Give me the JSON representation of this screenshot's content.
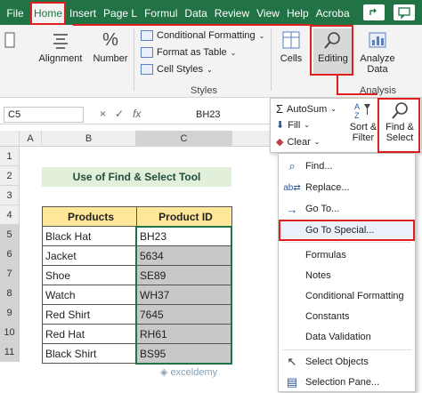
{
  "tabs": [
    "File",
    "Home",
    "Insert",
    "Page L",
    "Formul",
    "Data",
    "Review",
    "View",
    "Help",
    "Acroba"
  ],
  "ribbon": {
    "alignment_label": "Alignment",
    "number_label": "Number",
    "conditional_formatting": "Conditional Formatting",
    "format_as_table": "Format as Table",
    "cell_styles": "Cell Styles",
    "styles_group": "Styles",
    "cells_label": "Cells",
    "editing_label": "Editing",
    "analyze_label_1": "Analyze",
    "analyze_label_2": "Data",
    "analysis_group": "Analysis"
  },
  "formula_bar": {
    "name_box": "C5",
    "fx": "fx",
    "value": "BH23"
  },
  "grid": {
    "columns": [
      "A",
      "B",
      "C"
    ],
    "rows": [
      "1",
      "2",
      "3",
      "4",
      "5",
      "6",
      "7",
      "8",
      "9",
      "10",
      "11"
    ],
    "title": "Use of Find & Select Tool",
    "headers": [
      "Products",
      "Product ID"
    ],
    "data": [
      [
        "Black Hat",
        "BH23"
      ],
      [
        "Jacket",
        "5634"
      ],
      [
        "Shoe",
        "SE89"
      ],
      [
        "Watch",
        "WH37"
      ],
      [
        "Red Shirt",
        "7645"
      ],
      [
        "Red Hat",
        "RH61"
      ],
      [
        "Black Shirt",
        "BS95"
      ]
    ]
  },
  "editing_dropdown": {
    "autosum": "AutoSum",
    "fill": "Fill",
    "clear": "Clear",
    "sort_filter_1": "Sort &",
    "sort_filter_2": "Filter",
    "find_select_1": "Find &",
    "find_select_2": "Select"
  },
  "menu": {
    "find": "Find...",
    "replace": "Replace...",
    "goto": "Go To...",
    "goto_special": "Go To Special...",
    "formulas": "Formulas",
    "notes": "Notes",
    "conditional_formatting": "Conditional Formatting",
    "constants": "Constants",
    "data_validation": "Data Validation",
    "select_objects": "Select Objects",
    "selection_pane": "Selection Pane..."
  },
  "watermark": "exceldemy",
  "colors": {
    "excel_green": "#217346",
    "highlight_red": "#e02020",
    "header_yellow": "#ffe699",
    "title_green": "#e2efda"
  }
}
